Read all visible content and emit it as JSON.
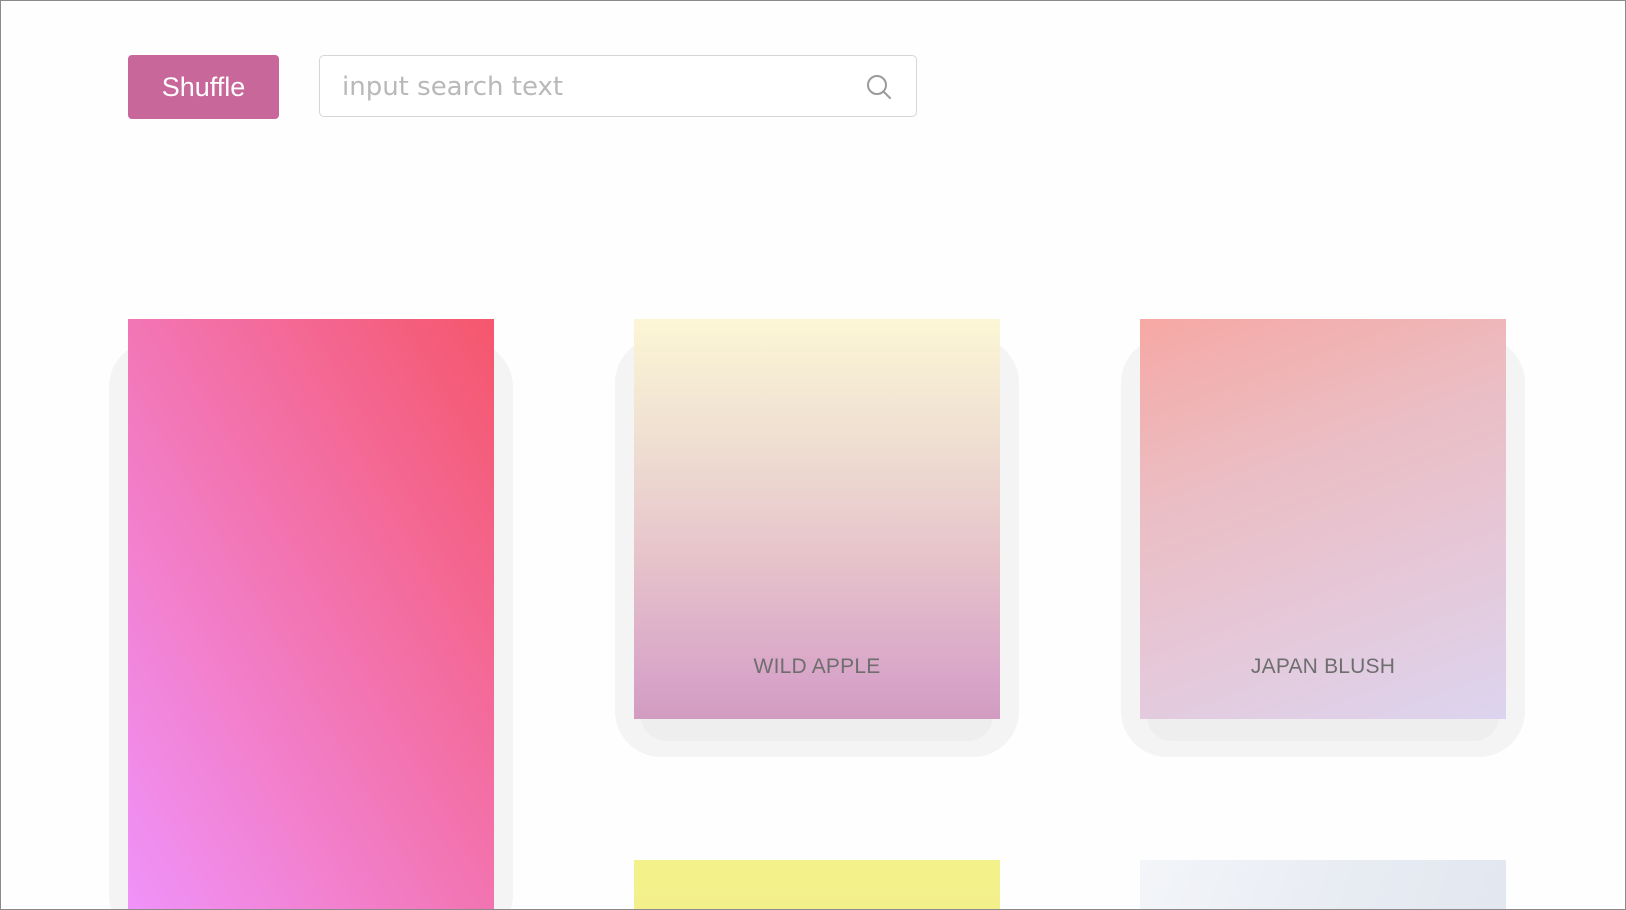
{
  "toolbar": {
    "shuffle_label": "Shuffle",
    "search_placeholder": "input search text",
    "accent_color": "#c8679a"
  },
  "cards": [
    {
      "label": "",
      "colors": [
        "#f093fb",
        "#f5576c"
      ]
    },
    {
      "label": "WILD APPLE",
      "colors": [
        "#fcf6d5",
        "#d19cc0"
      ]
    },
    {
      "label": "JAPAN BLUSH",
      "colors": [
        "#f6a8a4",
        "#dcd4ef"
      ]
    },
    {
      "label": "",
      "colors": [
        "#f3f28a",
        "#f3ef8c"
      ]
    },
    {
      "label": "",
      "colors": [
        "#f3f5f9",
        "#e2e7f0"
      ]
    }
  ]
}
